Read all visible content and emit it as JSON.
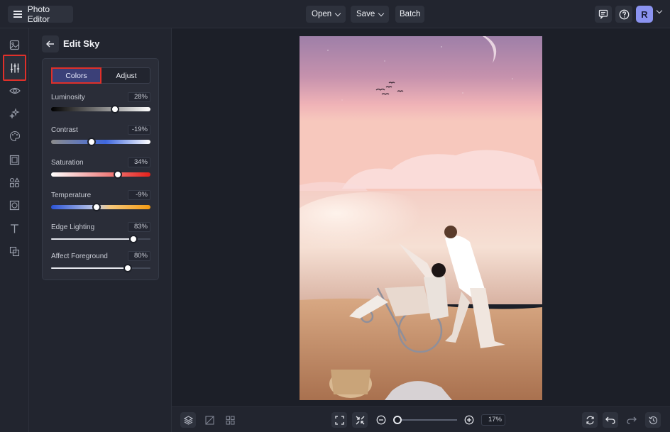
{
  "app": {
    "title": "Photo Editor"
  },
  "topbar": {
    "open_label": "Open",
    "save_label": "Save",
    "batch_label": "Batch",
    "avatar_initial": "R"
  },
  "rail": {
    "items": [
      "image-icon",
      "sliders-icon",
      "eye-icon",
      "magic-icon",
      "palette-icon",
      "frame-icon",
      "shapes-icon",
      "texture-icon",
      "text-icon",
      "overlay-icon"
    ],
    "active": "sliders-icon"
  },
  "panel": {
    "title": "Edit Sky",
    "tabs": [
      {
        "label": "Colors",
        "active": true
      },
      {
        "label": "Adjust",
        "active": false
      }
    ],
    "sliders": [
      {
        "label": "Luminosity",
        "value": "28%",
        "level": 0.64
      },
      {
        "label": "Contrast",
        "value": "-19%",
        "level": 0.41
      },
      {
        "label": "Saturation",
        "value": "34%",
        "level": 0.67
      },
      {
        "label": "Temperature",
        "value": "-9%",
        "level": 0.46
      },
      {
        "label": "Edge Lighting",
        "value": "83%",
        "level": 0.83
      },
      {
        "label": "Affect Foreground",
        "value": "80%",
        "level": 0.77
      }
    ]
  },
  "bottombar": {
    "zoom_value": "17%",
    "zoom_level": 0.17
  },
  "colors": {
    "accent": "#3b4078",
    "highlight_outline": "#e0302a",
    "avatar": "#8b93f0"
  }
}
